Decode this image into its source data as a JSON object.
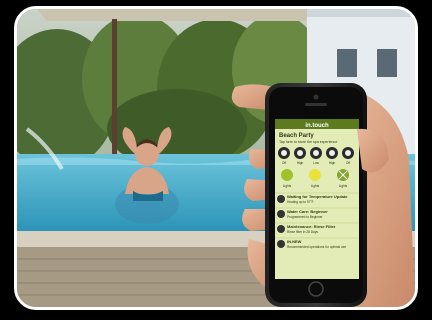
{
  "app": {
    "name": "in.touch",
    "scene_title": "Beach Party",
    "scene_hint": "Tap here to store the spa experience",
    "pump_labels": [
      "Off",
      "High",
      "Low",
      "High",
      "Off"
    ],
    "light_labels": [
      "Lights",
      "Lights",
      "Lights"
    ],
    "status_items": [
      {
        "title": "Waiting for Temperature Update",
        "subtitle": "Heating up to 97°F"
      },
      {
        "title": "Water Care: Beginner",
        "subtitle": "Programmed to Beginner"
      },
      {
        "title": "Maintenance: Rinse Filter",
        "subtitle": "Rinse filter in 28 Days"
      },
      {
        "title": "IN.NEW",
        "subtitle": "Recommended operations for optimal use"
      }
    ]
  },
  "colors": {
    "screen_bg": "#e3ecb6",
    "header_bg": "#5d7a1f",
    "accent": "#9fc22a",
    "water": "#38aac8"
  },
  "icons": {
    "pumps": "pump-dial-icon",
    "lights": "light-bulb-icon",
    "status": "status-circle-icon"
  }
}
